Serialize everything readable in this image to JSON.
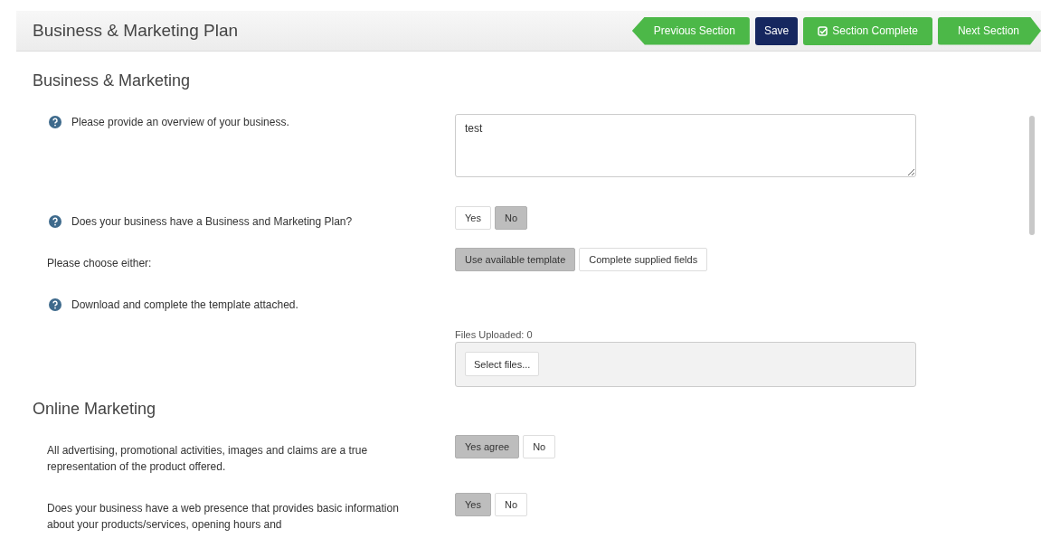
{
  "header": {
    "title": "Business & Marketing Plan",
    "buttons": [
      {
        "label": "Previous Section",
        "kind": "prev"
      },
      {
        "label": "Save",
        "kind": "primary"
      },
      {
        "label": "Section Complete",
        "kind": "complete"
      },
      {
        "label": "Next Section",
        "kind": "next"
      }
    ]
  },
  "sections": [
    {
      "heading": "Business & Marketing",
      "rows": [
        {
          "kind": "textarea",
          "help_icon": true,
          "label": "Please provide an overview of your business.",
          "value": "test"
        },
        {
          "kind": "toggle",
          "help_icon": true,
          "label": "Does your business have a Business and Marketing Plan?",
          "options": [
            {
              "label": "Yes",
              "selected": false
            },
            {
              "label": "No",
              "selected": true
            }
          ]
        },
        {
          "kind": "toggle",
          "help_icon": false,
          "label": "Please choose either:",
          "options": [
            {
              "label": "Use available template",
              "selected": true
            },
            {
              "label": "Complete supplied fields",
              "selected": false
            }
          ]
        },
        {
          "kind": "upload",
          "help_icon": true,
          "label": "Download and complete the template attached.",
          "count_label": "Files Uploaded: 0",
          "button": "Select files..."
        }
      ]
    },
    {
      "heading": "Online Marketing",
      "rows": [
        {
          "kind": "toggle",
          "help_icon": false,
          "label": "All advertising, promotional activities, images and claims are a true representation of the product offered.",
          "options": [
            {
              "label": "Yes agree",
              "selected": true
            },
            {
              "label": "No",
              "selected": false
            }
          ]
        },
        {
          "kind": "toggle",
          "help_icon": false,
          "label": "Does your business have a web presence that provides basic information about your products/services, opening hours and",
          "options": [
            {
              "label": "Yes",
              "selected": true
            },
            {
              "label": "No",
              "selected": false
            }
          ]
        }
      ]
    }
  ]
}
